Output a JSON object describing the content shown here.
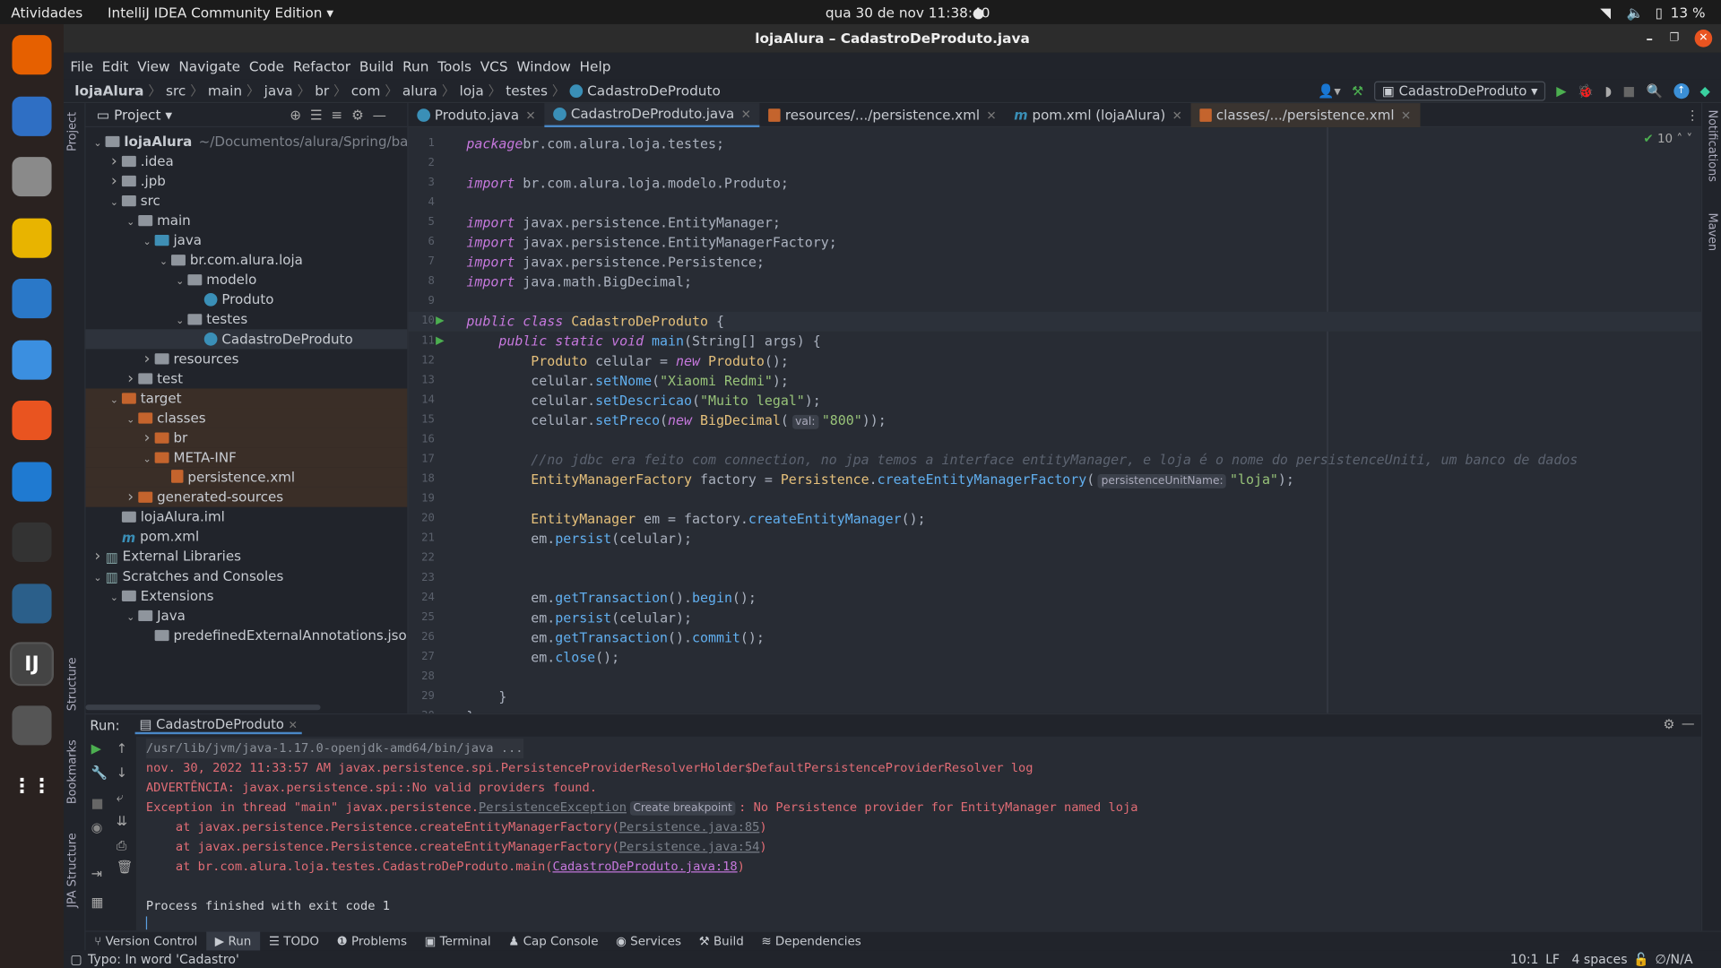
{
  "system": {
    "activities": "Atividades",
    "app_menu": "IntelliJ IDEA Community Edition",
    "clock": "qua 30 de nov  11:38:40",
    "battery": "13 %"
  },
  "dock": [
    {
      "name": "firefox",
      "color": "#e66000"
    },
    {
      "name": "thunderbird",
      "color": "#2f6fc4"
    },
    {
      "name": "files",
      "color": "#8a8a8a"
    },
    {
      "name": "rhythmbox",
      "color": "#e8b400"
    },
    {
      "name": "libreoffice-writer",
      "color": "#2a78c8"
    },
    {
      "name": "help",
      "color": "#3b8fe0"
    },
    {
      "name": "app-center",
      "color": "#e95420"
    },
    {
      "name": "vscode",
      "color": "#1f7ad1"
    },
    {
      "name": "terminal",
      "color": "#333"
    },
    {
      "name": "mysql-workbench",
      "color": "#2b5f8a"
    },
    {
      "name": "intellij",
      "color": "#444"
    },
    {
      "name": "java-ide",
      "color": "#555"
    },
    {
      "name": "show-apps",
      "color": "#2a2220"
    }
  ],
  "window": {
    "title": "lojaAlura – CadastroDeProduto.java"
  },
  "menu": [
    "File",
    "Edit",
    "View",
    "Navigate",
    "Code",
    "Refactor",
    "Build",
    "Run",
    "Tools",
    "VCS",
    "Window",
    "Help"
  ],
  "breadcrumb": [
    "lojaAlura",
    "src",
    "main",
    "java",
    "br",
    "com",
    "alura",
    "loja",
    "testes",
    "CadastroDeProduto"
  ],
  "toolbar": {
    "run_config": "CadastroDeProduto"
  },
  "project": {
    "title": "Project",
    "tree": [
      {
        "label": "lojaAlura",
        "hint": "~/Documentos/alura/Spring/banco-",
        "depth": 0,
        "arrow": "down",
        "icon": "folder"
      },
      {
        "label": ".idea",
        "depth": 1,
        "arrow": "right",
        "icon": "folder"
      },
      {
        "label": ".jpb",
        "depth": 1,
        "arrow": "right",
        "icon": "folder"
      },
      {
        "label": "src",
        "depth": 1,
        "arrow": "down",
        "icon": "folder"
      },
      {
        "label": "main",
        "depth": 2,
        "arrow": "down",
        "icon": "folder"
      },
      {
        "label": "java",
        "depth": 3,
        "arrow": "down",
        "icon": "folder-blue"
      },
      {
        "label": "br.com.alura.loja",
        "depth": 4,
        "arrow": "down",
        "icon": "folder"
      },
      {
        "label": "modelo",
        "depth": 5,
        "arrow": "down",
        "icon": "folder"
      },
      {
        "label": "Produto",
        "depth": 6,
        "icon": "cls"
      },
      {
        "label": "testes",
        "depth": 5,
        "arrow": "down",
        "icon": "folder"
      },
      {
        "label": "CadastroDeProduto",
        "depth": 6,
        "icon": "cls",
        "state": "sel"
      },
      {
        "label": "resources",
        "depth": 3,
        "arrow": "right",
        "icon": "folder"
      },
      {
        "label": "test",
        "depth": 2,
        "arrow": "right",
        "icon": "folder"
      },
      {
        "label": "target",
        "depth": 1,
        "arrow": "down",
        "icon": "folder-orange",
        "state": "orange"
      },
      {
        "label": "classes",
        "depth": 2,
        "arrow": "down",
        "icon": "folder-orange",
        "state": "orange"
      },
      {
        "label": "br",
        "depth": 3,
        "arrow": "right",
        "icon": "folder-orange",
        "state": "orange"
      },
      {
        "label": "META-INF",
        "depth": 3,
        "arrow": "down",
        "icon": "folder-orange",
        "state": "orange"
      },
      {
        "label": "persistence.xml",
        "depth": 4,
        "icon": "xml",
        "state": "orange"
      },
      {
        "label": "generated-sources",
        "depth": 2,
        "arrow": "right",
        "icon": "folder-orange",
        "state": "orange"
      },
      {
        "label": "lojaAlura.iml",
        "depth": 1,
        "icon": "folder"
      },
      {
        "label": "pom.xml",
        "depth": 1,
        "icon": "mvn"
      },
      {
        "label": "External Libraries",
        "depth": 0,
        "arrow": "right",
        "icon": "lib"
      },
      {
        "label": "Scratches and Consoles",
        "depth": 0,
        "arrow": "down",
        "icon": "lib"
      },
      {
        "label": "Extensions",
        "depth": 1,
        "arrow": "down",
        "icon": "folder"
      },
      {
        "label": "Java",
        "depth": 2,
        "arrow": "down",
        "icon": "folder"
      },
      {
        "label": "predefinedExternalAnnotations.json",
        "depth": 3,
        "icon": "folder"
      }
    ]
  },
  "tabs": [
    {
      "label": "Produto.java",
      "icon": "cls"
    },
    {
      "label": "CadastroDeProduto.java",
      "icon": "cls",
      "active": true
    },
    {
      "label": "resources/.../persistence.xml",
      "icon": "xml"
    },
    {
      "label": "pom.xml (lojaAlura)",
      "icon": "mvn"
    },
    {
      "label": "classes/.../persistence.xml",
      "icon": "xml",
      "xmltab": true
    }
  ],
  "editor": {
    "inspection_count": "10",
    "current_line": 10,
    "lines": [
      [
        [
          "kw",
          "package"
        ],
        [
          "",
          "br.com.alura.loja.testes;"
        ]
      ],
      [],
      [
        [
          "kw",
          "import"
        ],
        [
          "",
          " br.com.alura.loja.modelo.Produto;"
        ]
      ],
      [],
      [
        [
          "kw",
          "import"
        ],
        [
          "",
          " javax.persistence.EntityManager;"
        ]
      ],
      [
        [
          "kw",
          "import"
        ],
        [
          "",
          " javax.persistence.EntityManagerFactory;"
        ]
      ],
      [
        [
          "kw",
          "import"
        ],
        [
          "",
          " javax.persistence.Persistence;"
        ]
      ],
      [
        [
          "kw",
          "import"
        ],
        [
          "",
          " java.math.BigDecimal;"
        ]
      ],
      [],
      [
        [
          "kw",
          "public class "
        ],
        [
          "cl",
          "CadastroDeProduto"
        ],
        [
          "",
          " {"
        ]
      ],
      [
        [
          "kw",
          "    public static void "
        ],
        [
          "fn",
          "main"
        ],
        [
          "",
          "(String[] args) {"
        ]
      ],
      [
        [
          "",
          "        "
        ],
        [
          "cl",
          "Produto"
        ],
        [
          "",
          " celular = "
        ],
        [
          "kw",
          "new "
        ],
        [
          "cl",
          "Produto"
        ],
        [
          "",
          "();"
        ]
      ],
      [
        [
          "",
          "        celular."
        ],
        [
          "fn",
          "setNome"
        ],
        [
          "",
          "("
        ],
        [
          "str",
          "\"Xiaomi Redmi\""
        ],
        [
          "",
          ");"
        ]
      ],
      [
        [
          "",
          "        celular."
        ],
        [
          "fn",
          "setDescricao"
        ],
        [
          "",
          "("
        ],
        [
          "str",
          "\"Muito legal\""
        ],
        [
          "",
          ");"
        ]
      ],
      [
        [
          "",
          "        celular."
        ],
        [
          "fn",
          "setPreco"
        ],
        [
          "",
          "("
        ],
        [
          "kw",
          "new "
        ],
        [
          "cl",
          "BigDecimal"
        ],
        [
          "",
          "("
        ],
        [
          "hintbox",
          "val:"
        ],
        [
          "str",
          "\"800\""
        ],
        [
          "",
          "));"
        ]
      ],
      [],
      [
        [
          "cm",
          "        //no jdbc era feito com connection, no jpa temos a interface entityManager, e loja é o nome do persistenceUniti, um banco de dados"
        ]
      ],
      [
        [
          "",
          "        "
        ],
        [
          "cl",
          "EntityManagerFactory"
        ],
        [
          "",
          " factory = "
        ],
        [
          "cl",
          "Persistence"
        ],
        [
          "",
          "."
        ],
        [
          "fn",
          "createEntityManagerFactory"
        ],
        [
          "",
          "("
        ],
        [
          "hintbox",
          "persistenceUnitName:"
        ],
        [
          "str",
          "\"loja\""
        ],
        [
          "",
          ");"
        ]
      ],
      [],
      [
        [
          "",
          "        "
        ],
        [
          "cl",
          "EntityManager"
        ],
        [
          "",
          " em = factory."
        ],
        [
          "fn",
          "createEntityManager"
        ],
        [
          "",
          "();"
        ]
      ],
      [
        [
          "",
          "        em."
        ],
        [
          "fn",
          "persist"
        ],
        [
          "",
          "(celular);"
        ]
      ],
      [],
      [],
      [
        [
          "",
          "        em."
        ],
        [
          "fn",
          "getTransaction"
        ],
        [
          "",
          "()."
        ],
        [
          "fn",
          "begin"
        ],
        [
          "",
          "();"
        ]
      ],
      [
        [
          "",
          "        em."
        ],
        [
          "fn",
          "persist"
        ],
        [
          "",
          "(celular);"
        ]
      ],
      [
        [
          "",
          "        em."
        ],
        [
          "fn",
          "getTransaction"
        ],
        [
          "",
          "()."
        ],
        [
          "fn",
          "commit"
        ],
        [
          "",
          "();"
        ]
      ],
      [
        [
          "",
          "        em."
        ],
        [
          "fn",
          "close"
        ],
        [
          "",
          "();"
        ]
      ],
      [],
      [
        [
          "",
          "    }"
        ]
      ],
      [
        [
          "",
          "}"
        ]
      ]
    ]
  },
  "run": {
    "label": "Run:",
    "tab": "CadastroDeProduto",
    "lines": [
      [
        [
          "gray",
          "/usr/lib/jvm/java-1.17.0-openjdk-amd64/bin/java ..."
        ]
      ],
      [
        [
          "",
          "nov. 30, 2022 11:33:57 AM javax.persistence.spi.PersistenceProviderResolverHolder$DefaultPersistenceProviderResolver log"
        ]
      ],
      [
        [
          "",
          "ADVERTÊNCIA: javax.persistence.spi::No valid providers found."
        ]
      ],
      [
        [
          "",
          "Exception in thread \"main\" javax.persistence."
        ],
        [
          "link",
          "PersistenceException"
        ],
        [
          "hintbox",
          "Create breakpoint"
        ],
        [
          "",
          ": No Persistence provider for EntityManager named loja"
        ]
      ],
      [
        [
          "",
          "    at javax.persistence.Persistence.createEntityManagerFactory("
        ],
        [
          "link",
          "Persistence.java:85"
        ],
        [
          "",
          ")"
        ]
      ],
      [
        [
          "",
          "    at javax.persistence.Persistence.createEntityManagerFactory("
        ],
        [
          "link",
          "Persistence.java:54"
        ],
        [
          "",
          ")"
        ]
      ],
      [
        [
          "",
          "    at br.com.alura.loja.testes.CadastroDeProduto.main("
        ],
        [
          "plink",
          "CadastroDeProduto.java:18"
        ],
        [
          "",
          ")"
        ]
      ],
      [],
      [
        [
          "gray2",
          "Process finished with exit code 1"
        ]
      ]
    ]
  },
  "tool_tabs": [
    {
      "label": "Version Control",
      "icon": "branch"
    },
    {
      "label": "Run",
      "icon": "play",
      "active": true
    },
    {
      "label": "TODO",
      "icon": "list"
    },
    {
      "label": "Problems",
      "icon": "alert"
    },
    {
      "label": "Terminal",
      "icon": "terminal"
    },
    {
      "label": "Cap Console",
      "icon": "cap"
    },
    {
      "label": "Services",
      "icon": "services"
    },
    {
      "label": "Build",
      "icon": "hammer"
    },
    {
      "label": "Dependencies",
      "icon": "layers"
    }
  ],
  "side_labels": {
    "project": "Project",
    "structure": "Structure",
    "bookmarks": "Bookmarks",
    "jpa": "JPA Structure",
    "notifications": "Notifications",
    "maven": "Maven"
  },
  "status": {
    "message": "Typo: In word 'Cadastro'",
    "position": "10:1",
    "line_ending": "LF",
    "indent": "4 spaces",
    "vcs": "∅/N/A"
  }
}
